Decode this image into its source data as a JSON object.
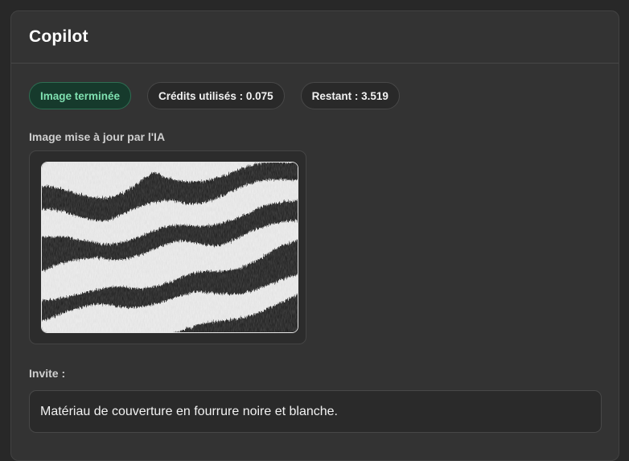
{
  "panel": {
    "title": "Copilot"
  },
  "badges": {
    "status": "Image terminée",
    "credits_used": "Crédits utilisés : 0.075",
    "remaining": "Restant : 3.519"
  },
  "image_section": {
    "label": "Image mise à jour par l'IA",
    "image_description_icon": "zebra-fur-image"
  },
  "prompt_section": {
    "label": "Invite :",
    "text": "Matériau de couverture en fourrure noire et blanche."
  },
  "colors": {
    "background": "#282828",
    "panel": "#333333",
    "status_badge_bg": "#163a2c",
    "status_badge_text": "#7fe0b0"
  }
}
